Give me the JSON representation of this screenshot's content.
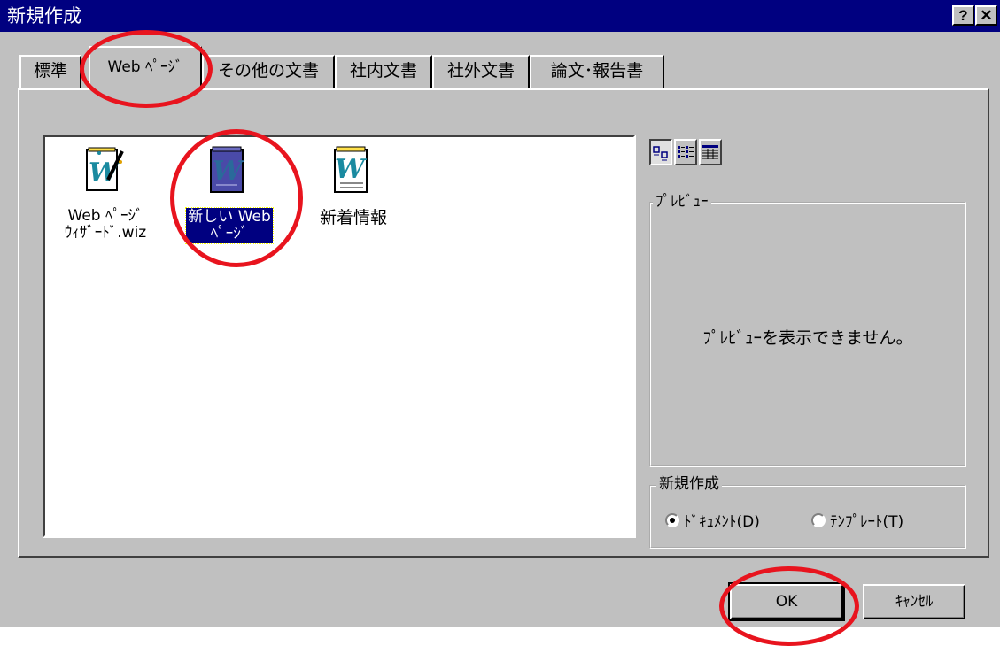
{
  "window": {
    "title": "新規作成",
    "help_label": "?",
    "close_label": "✕"
  },
  "tabs": [
    {
      "label": "標準"
    },
    {
      "label": "Web ﾍﾟｰｼﾞ"
    },
    {
      "label": "その他の文書"
    },
    {
      "label": "社内文書"
    },
    {
      "label": "社外文書"
    },
    {
      "label": "論文･報告書"
    }
  ],
  "active_tab": "Web ﾍﾟｰｼﾞ",
  "templates": [
    {
      "label_line1": "Web ﾍﾟｰｼﾞ",
      "label_line2": "ｳｨｻﾞｰﾄﾞ.wiz",
      "icon": "wizard-document-icon",
      "selected": false
    },
    {
      "label_line1": "新しい Web",
      "label_line2": "ﾍﾟｰｼﾞ",
      "icon": "word-web-page-icon",
      "selected": true
    },
    {
      "label_line1": "新着情報",
      "label_line2": "",
      "icon": "word-document-icon",
      "selected": false
    }
  ],
  "view_buttons": [
    "large-icons-icon",
    "list-view-icon",
    "details-view-icon"
  ],
  "preview": {
    "label": "ﾌﾟﾚﾋﾞｭｰ",
    "message": "ﾌﾟﾚﾋﾞｭｰを表示できません。"
  },
  "create_new": {
    "label": "新規作成",
    "options": [
      {
        "label": "ﾄﾞｷｭﾒﾝﾄ(D)",
        "checked": true
      },
      {
        "label": "ﾃﾝﾌﾟﾚｰﾄ(T)",
        "checked": false
      }
    ]
  },
  "buttons": {
    "ok": "OK",
    "cancel": "ｷｬﾝｾﾙ"
  },
  "colors": {
    "title_bar": "#000080",
    "face": "#c0c0c0",
    "annotation": "#e8141e",
    "selection": "#000080"
  }
}
